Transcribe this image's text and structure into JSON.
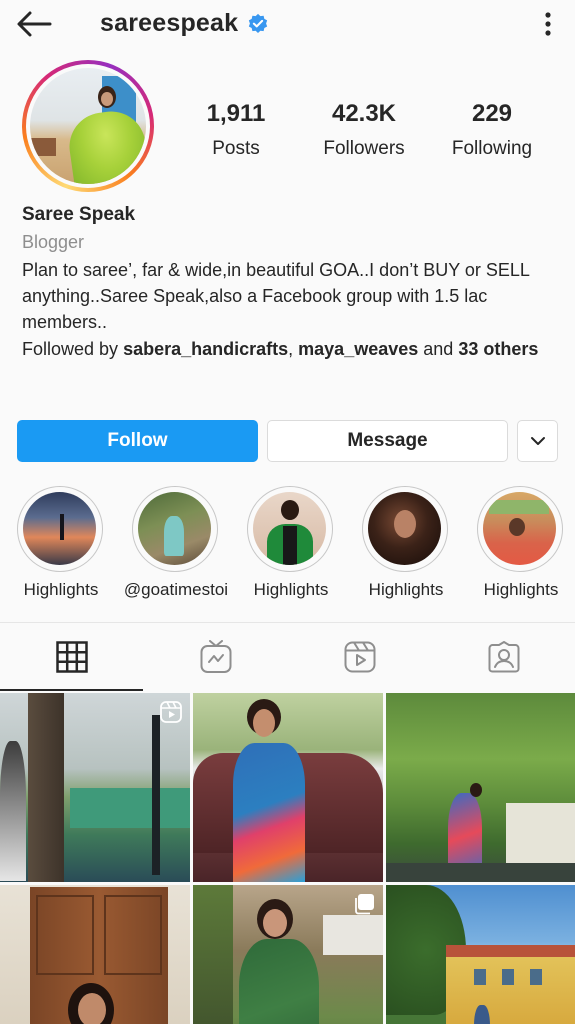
{
  "header": {
    "username": "sareespeak",
    "back_icon": "arrow-left-icon",
    "verified_icon": "verified-badge-icon",
    "more_icon": "more-vertical-icon"
  },
  "profile": {
    "avatar_alt": "profile-avatar",
    "stats": [
      {
        "value": "1,911",
        "label": "Posts"
      },
      {
        "value": "42.3K",
        "label": "Followers"
      },
      {
        "value": "229",
        "label": "Following"
      }
    ]
  },
  "bio": {
    "name": "Saree Speak",
    "category": "Blogger",
    "text": "Plan to saree’, far & wide,in beautiful GOA..I don’t BUY or SELL anything..Saree Speak,also a Facebook group with 1.5 lac members..",
    "followed_prefix": "Followed by ",
    "followed_user1": "sabera_handicrafts",
    "followed_sep": ", ",
    "followed_user2": "maya_weaves",
    "followed_and": " and ",
    "followed_others": "33 others"
  },
  "actions": {
    "follow_label": "Follow",
    "message_label": "Message",
    "dropdown_icon": "chevron-down-icon"
  },
  "highlights": [
    {
      "label": "Highlights"
    },
    {
      "label": "@goatimestoi"
    },
    {
      "label": "Highlights"
    },
    {
      "label": "Highlights"
    },
    {
      "label": "Highlights"
    }
  ],
  "tabs": [
    {
      "icon": "grid-icon",
      "active": true
    },
    {
      "icon": "igtv-icon",
      "active": false
    },
    {
      "icon": "reels-icon",
      "active": false
    },
    {
      "icon": "tagged-icon",
      "active": false
    }
  ],
  "colors": {
    "follow_button": "#1a9af3",
    "verified": "#3897f0",
    "text": "#262626",
    "secondary_text": "#8e8e8e",
    "background": "#fafafa"
  }
}
